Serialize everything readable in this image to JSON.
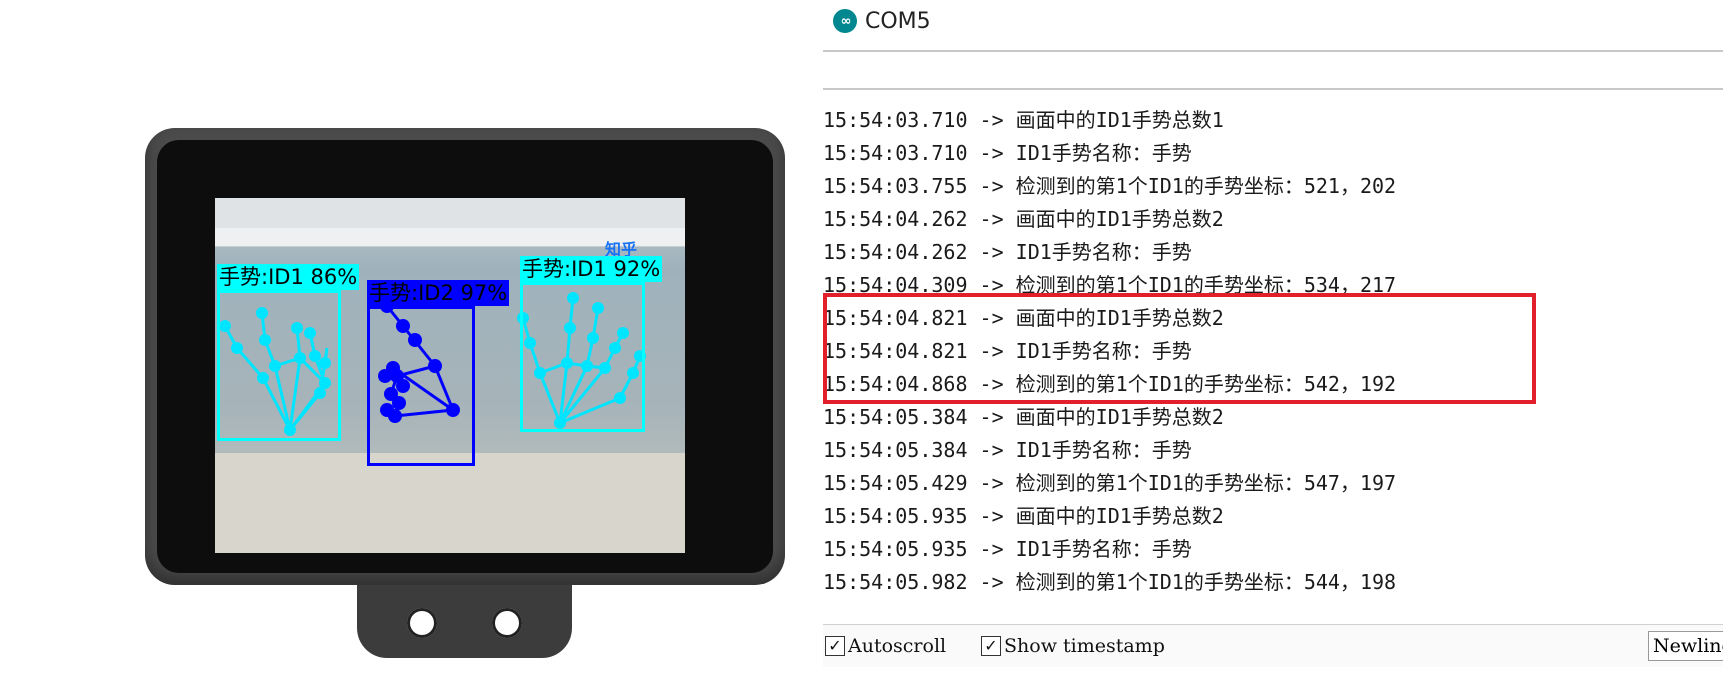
{
  "device": {
    "detections": [
      {
        "label": "手势:ID1 86%",
        "color": "#00ffff"
      },
      {
        "label": "手势:ID2 97%",
        "color": "#0000ff"
      },
      {
        "label": "手势:ID1 92%",
        "color": "#00ffff"
      }
    ],
    "screen_text": "知乎"
  },
  "monitor": {
    "title": "COM5",
    "icon": "arduino-infinity-icon",
    "log": [
      "15:54:03.710 -> 画面中的ID1手势总数1",
      "15:54:03.710 -> ID1手势名称：手势",
      "15:54:03.755 -> 检测到的第1个ID1的手势坐标：521，202",
      "15:54:04.262 -> 画面中的ID1手势总数2",
      "15:54:04.262 -> ID1手势名称：手势",
      "15:54:04.309 -> 检测到的第1个ID1的手势坐标：534，217",
      "15:54:04.821 -> 画面中的ID1手势总数2",
      "15:54:04.821 -> ID1手势名称：手势",
      "15:54:04.868 -> 检测到的第1个ID1的手势坐标：542，192",
      "15:54:05.384 -> 画面中的ID1手势总数2",
      "15:54:05.384 -> ID1手势名称：手势",
      "15:54:05.429 -> 检测到的第1个ID1的手势坐标：547，197",
      "15:54:05.935 -> 画面中的ID1手势总数2",
      "15:54:05.935 -> ID1手势名称：手势",
      "15:54:05.982 -> 检测到的第1个ID1的手势坐标：544，198"
    ],
    "highlight_color": "#e2202c",
    "footer": {
      "autoscroll_label": "Autoscroll",
      "autoscroll_checked": true,
      "timestamp_label": "Show timestamp",
      "timestamp_checked": true,
      "line_ending": "Newline"
    }
  }
}
